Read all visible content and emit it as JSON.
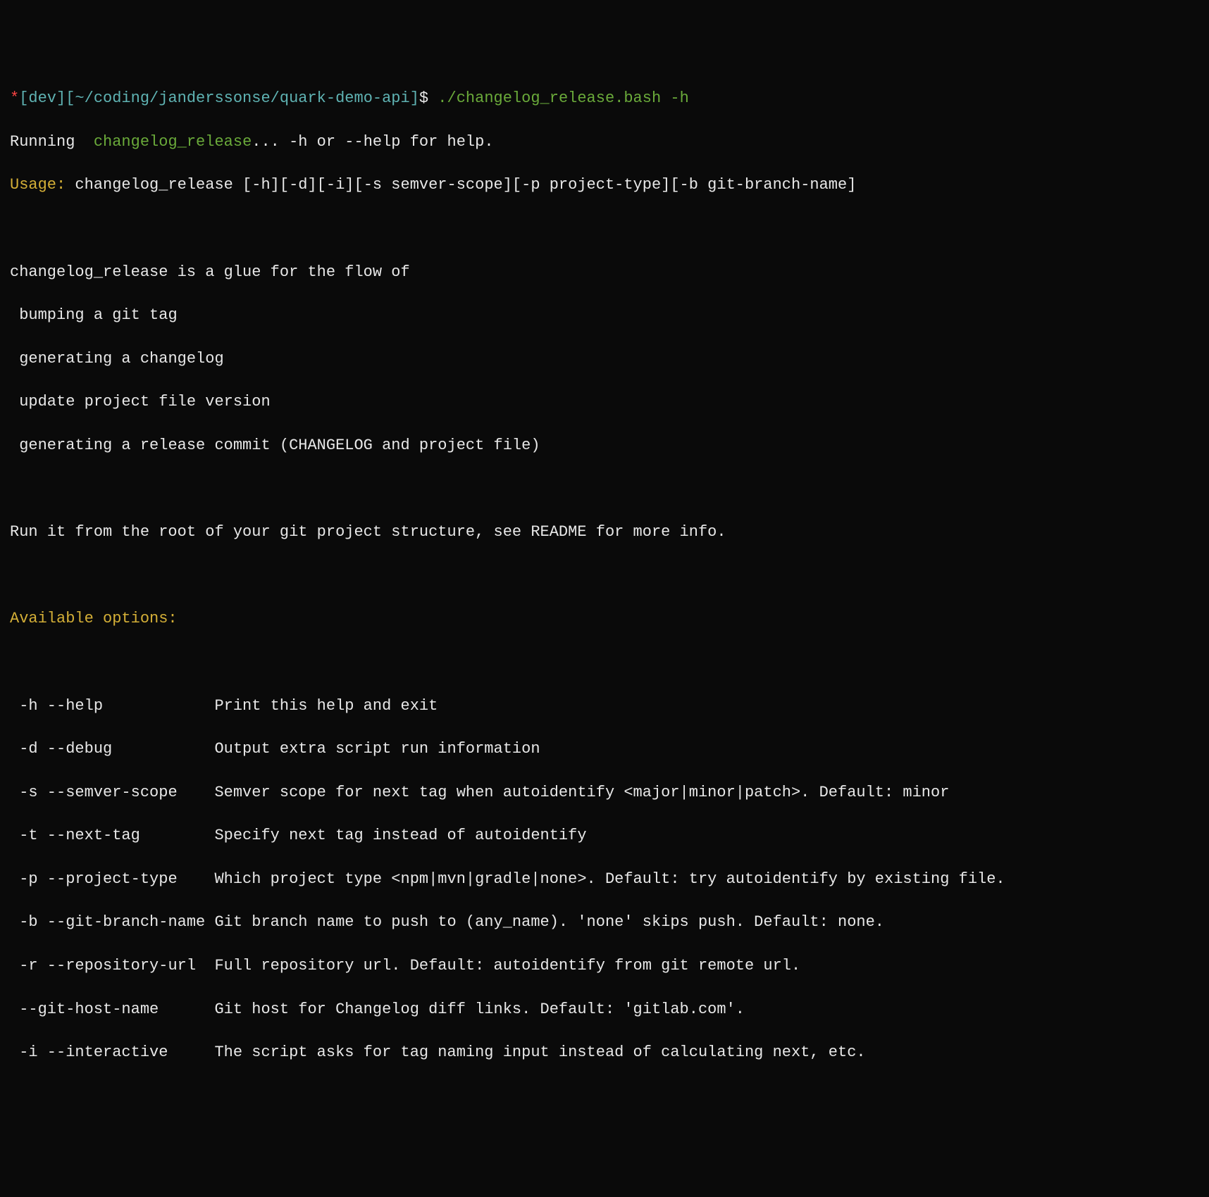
{
  "prompt": {
    "asterisk": "*",
    "env": "[dev]",
    "path": "[~/coding/janderssonse/quark-demo-api]",
    "dollar": "$",
    "command": " ./changelog_release.bash -h"
  },
  "running": {
    "prefix": "Running  ",
    "script_name": "changelog_release",
    "suffix": "... -h or --help for help."
  },
  "usage": {
    "label": "Usage:",
    "text": " changelog_release [-h][-d][-i][-s semver-scope][-p project-type][-b git-branch-name]"
  },
  "description": {
    "intro": "changelog_release is a glue for the flow of",
    "item1": " bumping a git tag",
    "item2": " generating a changelog",
    "item3": " update project file version",
    "item4": " generating a release commit (CHANGELOG and project file)",
    "footer": "Run it from the root of your git project structure, see README for more info."
  },
  "options_header": "Available options:",
  "options": {
    "help": " -h --help            Print this help and exit",
    "debug": " -d --debug           Output extra script run information",
    "semver": " -s --semver-scope    Semver scope for next tag when autoidentify <major|minor|patch>. Default: minor",
    "nexttag": " -t --next-tag        Specify next tag instead of autoidentify",
    "projecttype": " -p --project-type    Which project type <npm|mvn|gradle|none>. Default: try autoidentify by existing file.",
    "branch": " -b --git-branch-name Git branch name to push to (any_name). 'none' skips push. Default: none.",
    "repourl": " -r --repository-url  Full repository url. Default: autoidentify from git remote url.",
    "githost": " --git-host-name      Git host for Changelog diff links. Default: 'gitlab.com'.",
    "interactive": " -i --interactive     The script asks for tag naming input instead of calculating next, etc."
  }
}
